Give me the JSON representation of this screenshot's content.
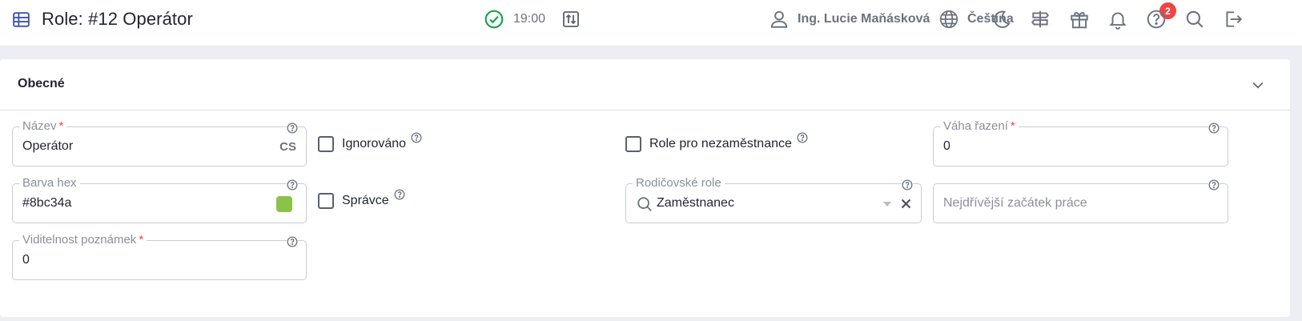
{
  "header": {
    "title": "Role: #12 Operátor",
    "time": "19:00",
    "user_name": "Ing. Lucie Maňásková",
    "language": "Čeština",
    "notification_count": "2"
  },
  "icons": {
    "title": "table-icon",
    "status": "check-circle-icon",
    "sort": "sort-arrows-icon",
    "user": "user-icon",
    "language": "globe-icon",
    "theme": "moon-icon",
    "signpost": "signpost-icon",
    "gift": "gift-icon",
    "notifications": "bell-icon",
    "help": "help-circle-icon",
    "search": "search-icon",
    "logout": "logout-icon"
  },
  "colors": {
    "accent": "#3f51b5",
    "status_ok": "#16a34a",
    "badge": "#ef4444",
    "required": "#ef4444"
  },
  "section": {
    "title": "Obecné"
  },
  "fields": {
    "name": {
      "label": "Název",
      "required": "*",
      "value": "Operátor",
      "lang": "CS"
    },
    "color_hex": {
      "label": "Barva hex",
      "value": "#8bc34a",
      "swatch": "#8bc34a"
    },
    "notes_visibility": {
      "label": "Viditelnost poznámek",
      "required": "*",
      "value": "0"
    },
    "ignored": {
      "label": "Ignorováno",
      "checked": false
    },
    "admin": {
      "label": "Správce",
      "checked": false
    },
    "non_employee": {
      "label": "Role pro nezaměstnance",
      "checked": false
    },
    "parent_roles": {
      "label": "Rodičovské role",
      "value": "Zaměstnanec"
    },
    "sort_weight": {
      "label": "Váha řazení",
      "required": "*",
      "value": "0"
    },
    "earliest_start": {
      "placeholder": "Nejdřívější začátek práce"
    }
  }
}
